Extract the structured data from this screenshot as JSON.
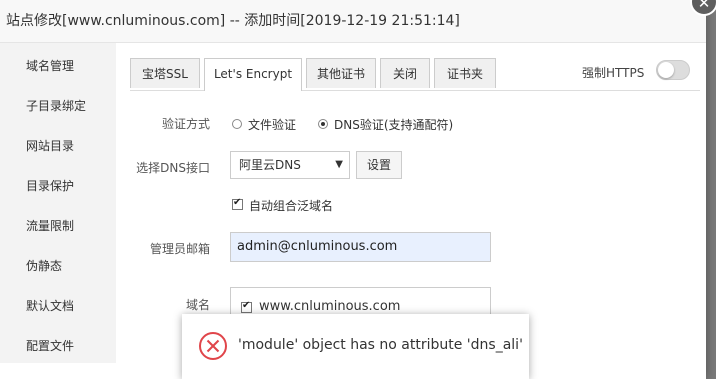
{
  "dialog": {
    "title": "站点修改[www.cnluminous.com] -- 添加时间[2019-12-19 21:51:14]",
    "close_icon": "close-icon"
  },
  "sidebar": {
    "items": [
      {
        "label": "域名管理"
      },
      {
        "label": "子目录绑定"
      },
      {
        "label": "网站目录"
      },
      {
        "label": "目录保护"
      },
      {
        "label": "流量限制"
      },
      {
        "label": "伪静态"
      },
      {
        "label": "默认文档"
      },
      {
        "label": "配置文件"
      }
    ]
  },
  "tabs": [
    {
      "label": "宝塔SSL",
      "active": false
    },
    {
      "label": "Let's Encrypt",
      "active": true
    },
    {
      "label": "其他证书",
      "active": false
    },
    {
      "label": "关闭",
      "active": false
    },
    {
      "label": "证书夹",
      "active": false
    }
  ],
  "force_https": {
    "label": "强制HTTPS",
    "enabled": false
  },
  "form": {
    "verify_label": "验证方式",
    "verify_options": [
      {
        "label": "文件验证",
        "checked": false
      },
      {
        "label": "DNS验证(支持通配符)",
        "checked": true
      }
    ],
    "dns_label": "选择DNS接口",
    "dns_selected": "阿里云DNS",
    "setting_button": "设置",
    "auto_wildcard": {
      "label": "自动组合泛域名",
      "checked": true
    },
    "email_label": "管理员邮箱",
    "email_value": "admin@cnluminous.com",
    "domain_label": "域名",
    "domains": [
      {
        "label": "www.cnluminous.com",
        "checked": true
      }
    ]
  },
  "toast": {
    "message": "'module' object has no attribute 'dns_ali'",
    "icon": "error-icon",
    "color": "#e0454a"
  }
}
